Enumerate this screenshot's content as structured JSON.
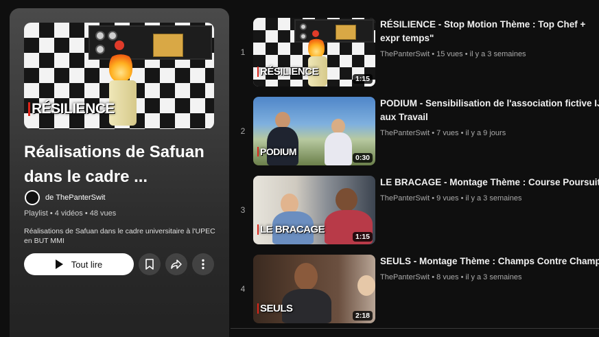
{
  "playlist": {
    "hero_thumb_label": "RÉSILIENCE",
    "title": "Réalisations de Safuan dans le cadre ...",
    "owner_prefix": "de",
    "owner": "ThePanterSwit",
    "meta": "Playlist • 4 vidéos • 48 vues",
    "description": "Réalisations de Safuan dans le cadre universitaire à l'UPEC en BUT MMI",
    "play_all_label": "Tout lire",
    "icons": [
      "play-icon",
      "save-icon",
      "share-icon",
      "more-icon"
    ]
  },
  "videos": [
    {
      "index": "1",
      "thumb_label": "RÉSILIENCE",
      "duration": "1:15",
      "title": "RÉSILIENCE - Stop Motion Thème : Top Chef + expr temps\"",
      "channel": "ThePanterSwit",
      "stats": "15 vues • il y a 3 semaines"
    },
    {
      "index": "2",
      "thumb_label": "PODIUM",
      "duration": "0:30",
      "title": "PODIUM - Sensibilisation de l'association fictive IJ aux Travail",
      "channel": "ThePanterSwit",
      "stats": "7 vues • il y a 9 jours"
    },
    {
      "index": "3",
      "thumb_label": "LE BRACAGE",
      "duration": "1:15",
      "title": "LE BRACAGE - Montage Thème : Course Poursuite",
      "channel": "ThePanterSwit",
      "stats": "9 vues • il y a 3 semaines"
    },
    {
      "index": "4",
      "thumb_label": "SEULS",
      "duration": "2:18",
      "title": "SEULS - Montage Thème : Champs Contre Champs",
      "channel": "ThePanterSwit",
      "stats": "8 vues • il y a 3 semaines"
    }
  ],
  "colors": {
    "background": "#0f0f0f",
    "accent_red": "#e1251b",
    "text_primary": "#f1f1f1",
    "text_secondary": "#aaaaaa"
  }
}
